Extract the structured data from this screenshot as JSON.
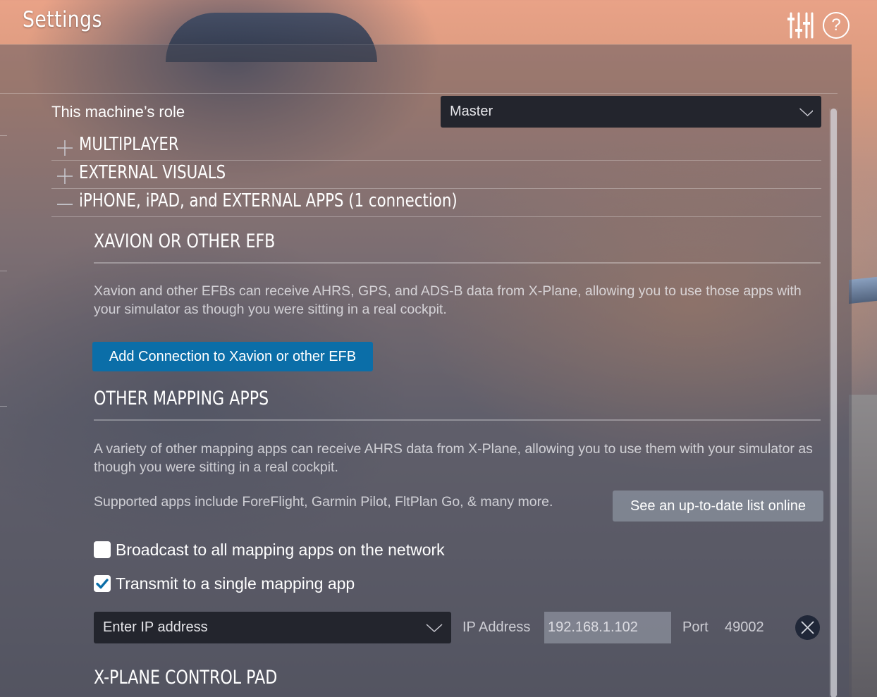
{
  "header": {
    "title": "Settings",
    "help_glyph": "?",
    "icons": [
      "sliders-icon",
      "help-icon"
    ]
  },
  "role": {
    "label": "This machine’s role",
    "selected": "Master"
  },
  "sections": [
    {
      "label": "MULTIPLAYER",
      "state": "collapsed"
    },
    {
      "label": "EXTERNAL VISUALS",
      "state": "collapsed"
    },
    {
      "label": "iPHONE, iPAD, and EXTERNAL APPS (1 connection)",
      "state": "expanded"
    }
  ],
  "efb": {
    "heading": "XAVION OR OTHER EFB",
    "description": "Xavion and other EFBs can receive AHRS, GPS, and ADS-B data from X-Plane, allowing you to use those apps with your simulator as though you were sitting in a real cockpit.",
    "button_label": "Add Connection to Xavion or other EFB"
  },
  "mapping": {
    "heading": "OTHER MAPPING APPS",
    "description": "A variety of other mapping apps can receive AHRS data from X-Plane, allowing you to use them with your simulator as though you were sitting in a real cockpit.",
    "supported_text": "Supported apps include ForeFlight, Garmin Pilot, FltPlan Go, & many more.",
    "list_button_label": "See an up-to-date list online",
    "broadcast_label": "Broadcast to all mapping apps on the network",
    "broadcast_checked": false,
    "single_label": "Transmit to a single mapping app",
    "single_checked": true,
    "ip_select_value": "Enter IP address",
    "ip_label": "IP Address",
    "ip_value": "192.168.1.102",
    "port_label": "Port",
    "port_value": "49002"
  },
  "control_pad": {
    "heading": "X-PLANE CONTROL PAD"
  },
  "colors": {
    "accent_blue": "#0b6ea8",
    "checkbox_check": "#0b6ea8",
    "dropdown_bg": "#23252d"
  }
}
